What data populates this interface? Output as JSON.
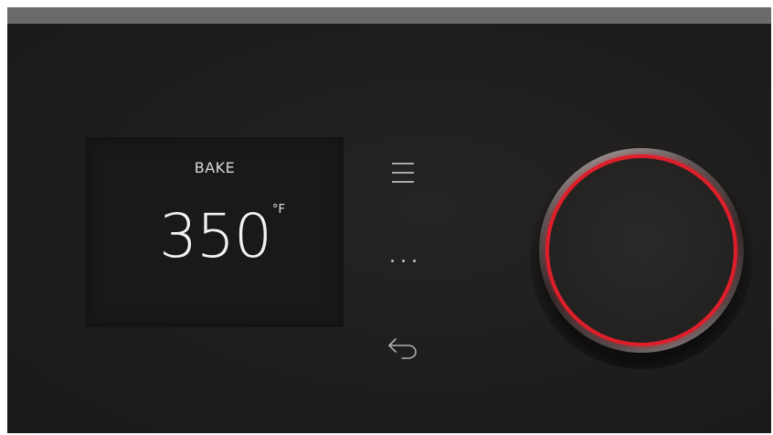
{
  "display": {
    "mode": "BAKE",
    "temperature": "350",
    "unit": "°F"
  },
  "controls": {
    "menu_icon": "menu-icon",
    "more_icon": "more-dots-icon",
    "back_icon": "back-arrow-icon"
  },
  "colors": {
    "background": "#1e1d1c",
    "top_strip": "#6a6a6a",
    "knob_ring": "#e01e2a",
    "text": "#f2f2f2"
  }
}
